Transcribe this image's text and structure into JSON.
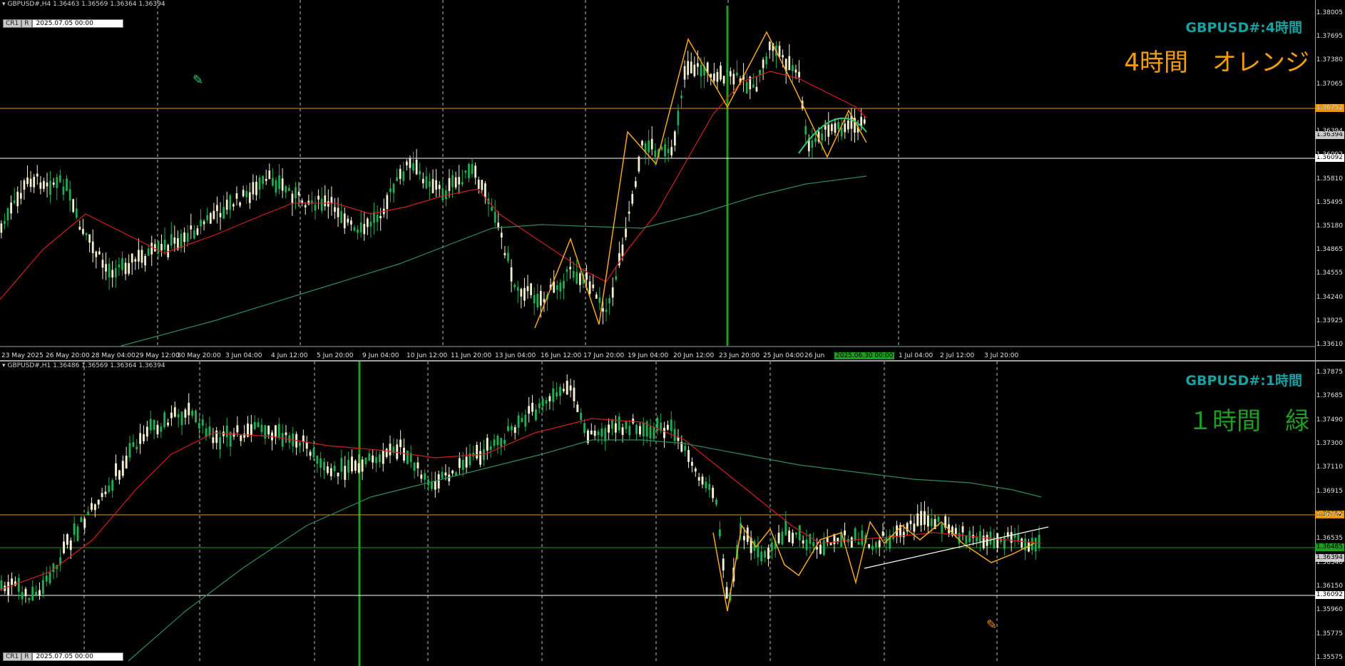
{
  "h4": {
    "header": "GBPUSD#,H4  1.36463 1.36569 1.36364 1.36394",
    "ctl_a": "CR1",
    "ctl_b": "R",
    "datetime": "2025.07.05 00:00",
    "symbol_label": "GBPUSD#:4時間",
    "big_label": "4時間　オレンジ",
    "big_color": "#f39c12",
    "prices": [
      "1.38005",
      "1.37695",
      "1.37380",
      "1.37065",
      "1.36752",
      "1.36394",
      "1.36092",
      "1.35810",
      "1.35495",
      "1.35180",
      "1.34865",
      "1.34555",
      "1.34240",
      "1.33925",
      "1.33610"
    ],
    "tag_orange": "1.36752",
    "tag_current": "1.36394",
    "tag_white": "1.36092",
    "time_labels": [
      "23 May 2025",
      "26 May 20:00",
      "28 May 04:00",
      "29 May 12:00",
      "30 May 20:00",
      "3 Jun 04:00",
      "4 Jun 12:00",
      "5 Jun 20:00",
      "9 Jun 04:00",
      "10 Jun 12:00",
      "11 Jun 20:00",
      "13 Jun 04:00",
      "16 Jun 12:00",
      "17 Jun 20:00",
      "19 Jun 04:00",
      "20 Jun 12:00",
      "23 Jun 20:00",
      "25 Jun 04:00",
      "26 Jun",
      "2025.06.30 00:00",
      "1 Jul 04:00",
      "2 Jul 12:00",
      "3 Jul 20:00"
    ]
  },
  "h1": {
    "header": "GBPUSD#,H1  1.36486 1.36569 1.36364 1.36394",
    "ctl_a": "CR1",
    "ctl_b": "R",
    "datetime": "2025.07.05 00:00",
    "symbol_label": "GBPUSD#:1時間",
    "big_label": "１時間　緑",
    "big_color": "#1e9e1e",
    "prices": [
      "1.37875",
      "1.37685",
      "1.37490",
      "1.37300",
      "1.37110",
      "1.36915",
      "1.36725",
      "1.36535",
      "1.36340",
      "1.36150",
      "1.35960",
      "1.35775",
      "1.35575"
    ],
    "tag_orange": "1.36752",
    "tag_green": "1.36485",
    "tag_current": "1.36394",
    "tag_white": "1.36092"
  },
  "colors": {
    "bull": "#1fae52",
    "bear": "#f4f1d0",
    "ma_red": "#d41e1e",
    "ma_green": "#2e8b57",
    "zigzag": "#f5a623",
    "orange_line": "#e8960c",
    "white_line": "#ffffff",
    "green_vline": "#1e9e1e"
  }
}
